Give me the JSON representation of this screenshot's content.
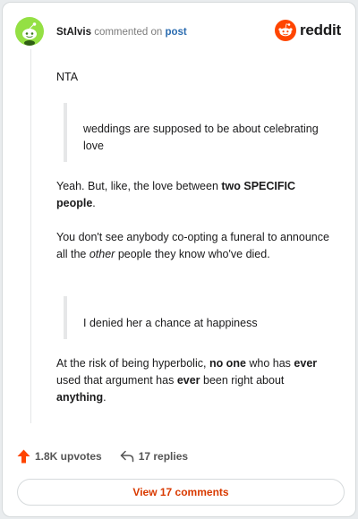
{
  "header": {
    "username": "StAlvis",
    "verb": "commented on",
    "post_link": "post",
    "logo_text": "reddit"
  },
  "comment": {
    "p1": "NTA",
    "quote1": "weddings are supposed to be about celebrating love",
    "p2_a": "Yeah. But, like, the love between ",
    "p2_b": "two SPECIFIC people",
    "p2_c": ".",
    "p3_a": "You don't see anybody co-opting a funeral to announce all the ",
    "p3_b": "other",
    "p3_c": " people they know who've died.",
    "quote2": "I denied her a chance at happiness",
    "p4_a": "At the risk of being hyperbolic, ",
    "p4_b": "no one",
    "p4_c": " who has ",
    "p4_d": "ever",
    "p4_e": " used that argument has ",
    "p4_f": "ever",
    "p4_g": " been right about ",
    "p4_h": "anything",
    "p4_i": "."
  },
  "actions": {
    "upvotes": "1.8K upvotes",
    "replies": "17 replies"
  },
  "footer": {
    "view_comments": "View 17 comments"
  },
  "colors": {
    "reddit_orange": "#ff4500",
    "avatar_green": "#94e044",
    "link_blue": "#2b6cb0",
    "view_button_text": "#d93a00"
  },
  "icons": {
    "avatar": "snoo-avatar-icon",
    "logo": "reddit-logo-icon",
    "upvote": "upvote-arrow-icon",
    "reply": "reply-arrow-icon"
  }
}
